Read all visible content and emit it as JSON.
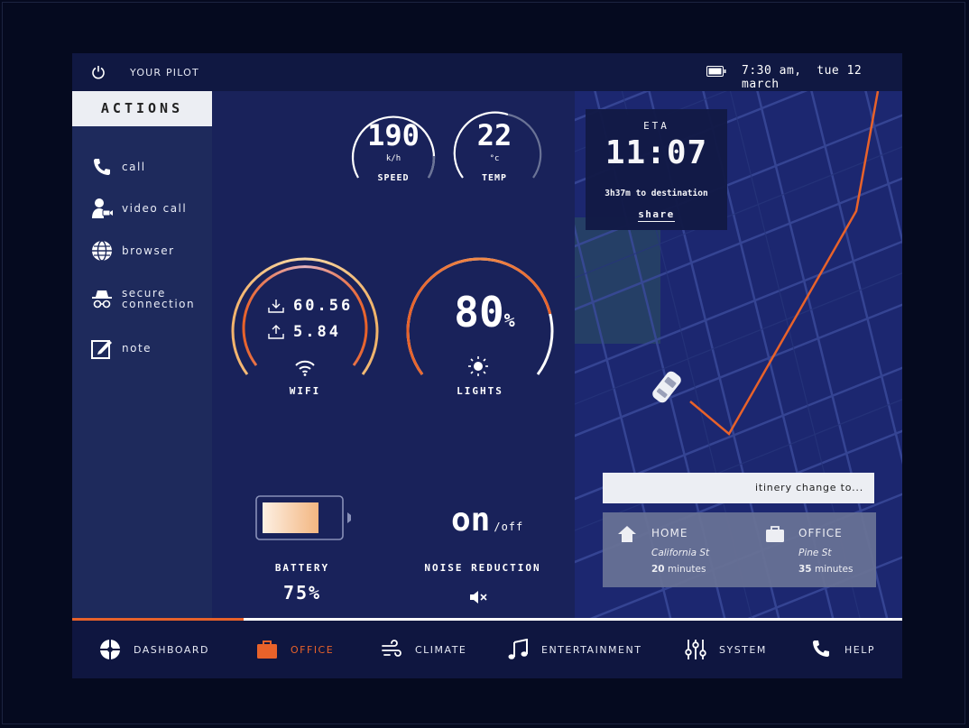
{
  "topbar": {
    "pilot_label": "YOUR PILOT",
    "time": "7:30 am,",
    "date": "tue 12 march"
  },
  "sidebar": {
    "header": "ACTIONS",
    "items": [
      {
        "label": "call",
        "icon": "phone-icon"
      },
      {
        "label": "video call",
        "icon": "video-call-icon"
      },
      {
        "label": "browser",
        "icon": "globe-icon"
      },
      {
        "label": "secure",
        "label2": "connection",
        "icon": "incognito-icon"
      },
      {
        "label": "note",
        "icon": "note-icon"
      }
    ]
  },
  "gauges": {
    "speed": {
      "value": "190",
      "unit": "k/h",
      "label": "SPEED"
    },
    "temp": {
      "value": "22",
      "unit": "°c",
      "label": "TEMP"
    },
    "wifi": {
      "download": "60.56",
      "upload": "5.84",
      "label": "WIFI"
    },
    "lights": {
      "value": "80",
      "unit": "%",
      "label": "LIGHTS",
      "level": 0.8
    },
    "battery": {
      "label": "BATTERY",
      "value": "75%",
      "level": 0.75
    },
    "noise": {
      "state_on": "on",
      "state_off": "/off",
      "label": "NOISE REDUCTION"
    }
  },
  "eta": {
    "label": "ETA",
    "time": "11:07",
    "remaining": "3h37m to destination",
    "share": "share"
  },
  "itinerary": {
    "prompt": "itinery change to...",
    "options": [
      {
        "title": "HOME",
        "street": "California St",
        "minutes_num": "20",
        "minutes_label": "minutes",
        "icon": "home-icon"
      },
      {
        "title": "OFFICE",
        "street": "Pine St",
        "minutes_num": "35",
        "minutes_label": "minutes",
        "icon": "briefcase-icon"
      }
    ]
  },
  "nav": {
    "progress": 0.207,
    "items": [
      {
        "label": "DASHBOARD",
        "icon": "dashboard-icon",
        "active": false
      },
      {
        "label": "OFFICE",
        "icon": "briefcase-icon",
        "active": true
      },
      {
        "label": "CLIMATE",
        "icon": "wind-icon",
        "active": false
      },
      {
        "label": "ENTERTAINMENT",
        "icon": "music-icon",
        "active": false
      },
      {
        "label": "SYSTEM",
        "icon": "sliders-icon",
        "active": false
      },
      {
        "label": "HELP",
        "icon": "phone-icon",
        "active": false
      }
    ]
  },
  "colors": {
    "accent": "#e8622a",
    "background": "#050a1f",
    "panel": "#19225a",
    "sidebar": "#1e2a5c",
    "map": "#1c2770"
  }
}
